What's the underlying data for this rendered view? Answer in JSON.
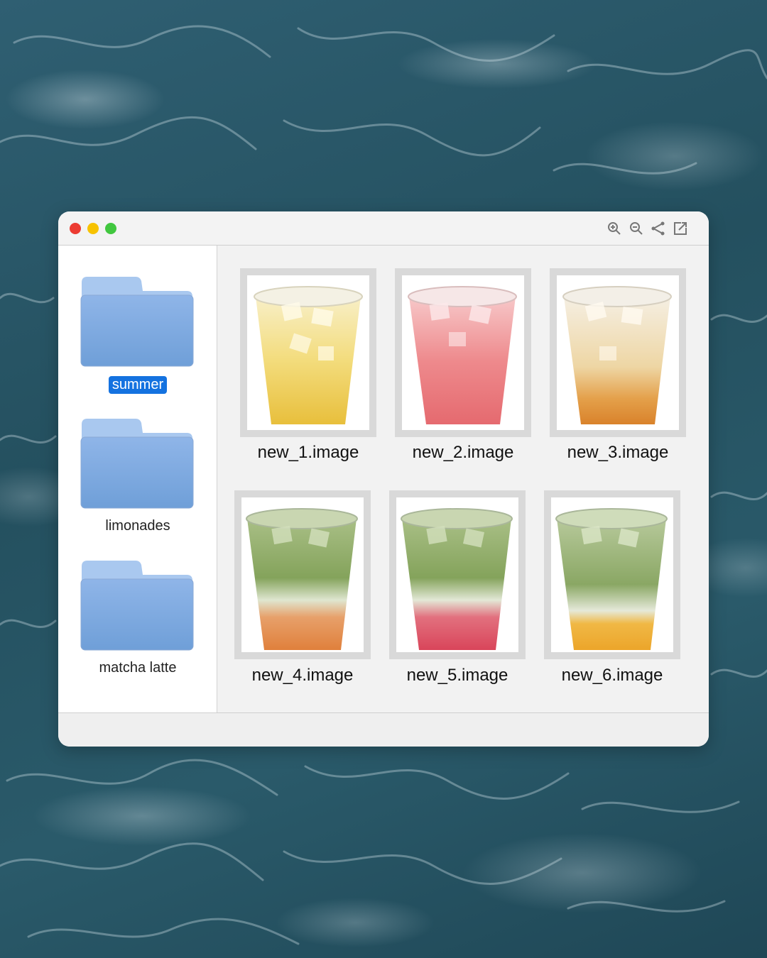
{
  "window": {
    "controls": [
      "close",
      "minimize",
      "maximize"
    ],
    "toolbar_icons": [
      "zoom-in-icon",
      "zoom-out-icon",
      "share-icon",
      "open-external-icon"
    ]
  },
  "sidebar": {
    "folders": [
      {
        "label": "summer",
        "selected": true
      },
      {
        "label": "limonades",
        "selected": false
      },
      {
        "label": "matcha latte",
        "selected": false
      }
    ]
  },
  "grid": {
    "items": [
      {
        "label": "new_1.image"
      },
      {
        "label": "new_2.image"
      },
      {
        "label": "new_3.image"
      },
      {
        "label": "new_4.image"
      },
      {
        "label": "new_5.image"
      },
      {
        "label": "new_6.image"
      }
    ]
  },
  "colors": {
    "selection": "#1472e0",
    "folder": "#7fa8e0",
    "close": "#ec3b32",
    "minimize": "#f7c200",
    "maximize": "#41c73f"
  }
}
